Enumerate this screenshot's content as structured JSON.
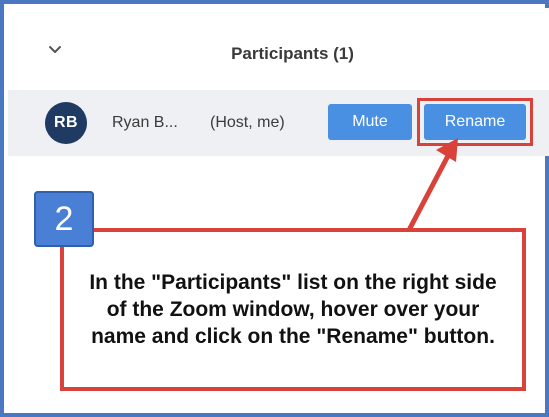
{
  "panel": {
    "title": "Participants (1)",
    "collapse_icon": "chevron-down-icon"
  },
  "participant": {
    "initials": "RB",
    "name": "Ryan B...",
    "role": "(Host, me)",
    "mute_label": "Mute",
    "rename_label": "Rename"
  },
  "annotation": {
    "step_number": "2",
    "instruction": "In the \"Participants\" list on the right side of the Zoom window, hover over your name and click on the \"Rename\" button."
  },
  "colors": {
    "frame": "#4a78c2",
    "button": "#4a90e2",
    "highlight": "#d9423a",
    "avatar": "#1f3a63",
    "row_background": "#eef0f3"
  }
}
